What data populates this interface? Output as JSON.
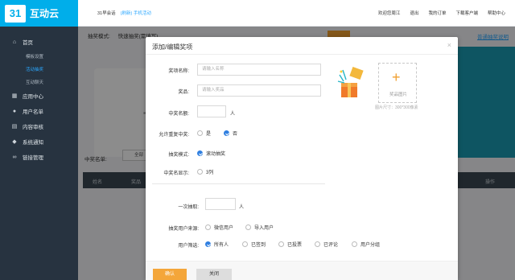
{
  "logo": {
    "mark": "31",
    "text": "互动云"
  },
  "sidebar": {
    "items": [
      {
        "icon": "home-icon",
        "glyph": "⌂",
        "label": "首页"
      },
      {
        "sub": "模板设置"
      },
      {
        "sub": "活动抽奖",
        "active": true
      },
      {
        "sub": "互动聊天"
      },
      {
        "icon": "apps-icon",
        "glyph": "▦",
        "label": "应用中心"
      },
      {
        "icon": "user-icon",
        "glyph": "●",
        "label": "用户名单"
      },
      {
        "icon": "review-icon",
        "glyph": "▤",
        "label": "内容审核"
      },
      {
        "icon": "bell-icon",
        "glyph": "◆",
        "label": "系统通知"
      },
      {
        "icon": "link-icon",
        "glyph": "∞",
        "label": "链接管理"
      }
    ]
  },
  "topbar": {
    "crumb": "31早会话",
    "crumb_link": "(刷新) 手机活动",
    "right": [
      "欢迎您周江",
      "退出",
      "我的订单",
      "下载客户端",
      "帮助中心"
    ]
  },
  "background": {
    "mode_label": "抽奖模式:",
    "mode_value": "快速抽奖(需填写)",
    "top_link": "普通抽奖说明",
    "add_label": "添加",
    "winner_label": "中奖名单:",
    "winner_input": "全部",
    "table_cols": [
      "姓名",
      "奖品",
      "操作"
    ]
  },
  "modal": {
    "title": "添加/编辑奖项",
    "close": "×",
    "prize_name_label": "奖项名称:",
    "prize_name_placeholder": "请输入名称",
    "prize_label": "奖品:",
    "prize_placeholder": "请输入奖品",
    "count_label": "中奖名额:",
    "count_unit": "人",
    "repeat_label": "允许重复中奖:",
    "repeat_yes": "是",
    "repeat_no": "否",
    "mode_label": "抽奖模式:",
    "mode_option": "滚动抽奖",
    "display_label": "中奖名显示:",
    "display_option": "3列",
    "once_label": "一次抽取:",
    "once_unit": "人",
    "source_label": "抽奖用户来源:",
    "source_opt1": "微信用户",
    "source_opt2": "导入用户",
    "filter_label": "用户筛选:",
    "filters": [
      "所有人",
      "已签到",
      "已投票",
      "已评论",
      "用户分组"
    ],
    "upload_text": "奖品图片",
    "upload_hint": "图片尺寸：300*300像素",
    "ok": "确认",
    "cancel": "关闭"
  }
}
